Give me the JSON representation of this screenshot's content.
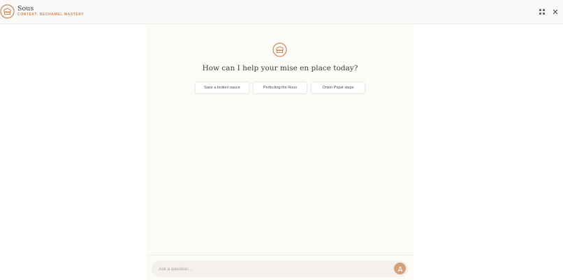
{
  "header": {
    "title": "Sous",
    "context_label": "CONTEXT: BECHAMEL MASTERY",
    "logo_icon": "chef-hat-icon",
    "grid_icon": "grid-icon",
    "close_icon": "close-icon"
  },
  "main": {
    "hero_icon": "chef-hat-icon",
    "headline": "How can I help your mise en place today?",
    "suggestions": [
      {
        "label": "Save a broken sauce"
      },
      {
        "label": "Perfecting the Roux"
      },
      {
        "label": "Onion Piqué steps"
      }
    ]
  },
  "composer": {
    "placeholder": "Ask a question...",
    "send_icon": "send-icon"
  },
  "colors": {
    "accent": "#c98a5a",
    "send_button": "#d2a17a",
    "panel_bg": "#fdfbf8",
    "header_bg": "#faf9f7"
  }
}
